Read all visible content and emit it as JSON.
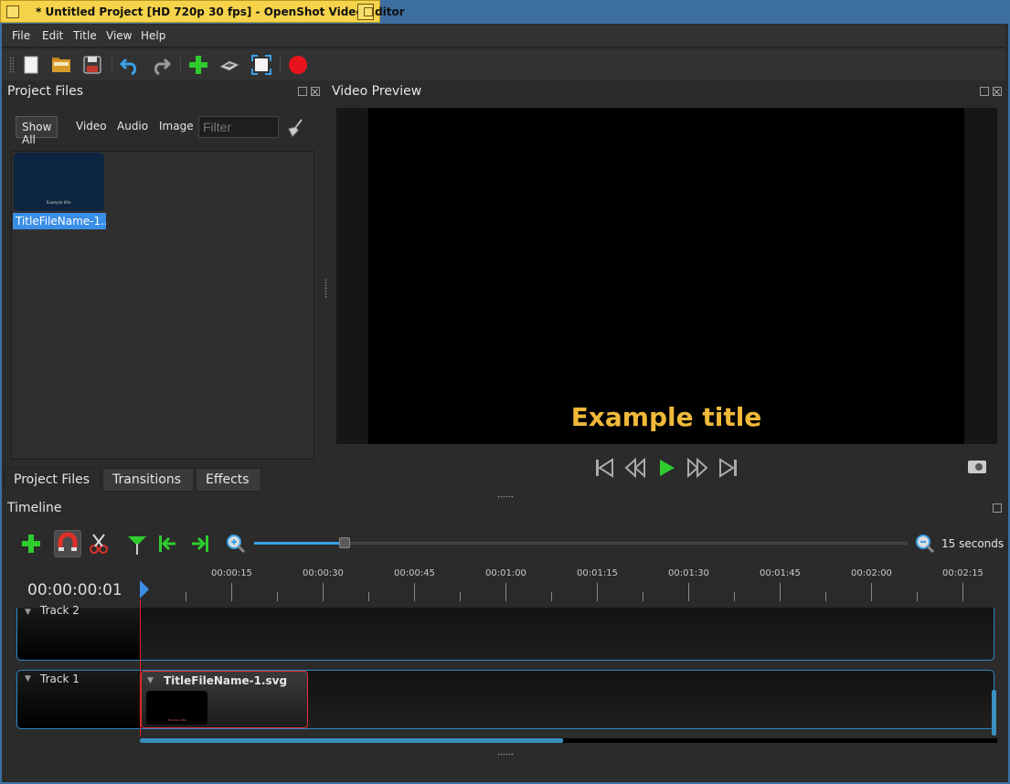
{
  "window": {
    "title": "* Untitled Project [HD 720p 30 fps] - OpenShot Video Editor"
  },
  "menu": [
    "File",
    "Edit",
    "Title",
    "View",
    "Help"
  ],
  "toolbar": {
    "icons": [
      "new-project-icon",
      "open-project-icon",
      "save-project-icon",
      "undo-icon",
      "redo-icon",
      "import-files-icon",
      "profile-icon",
      "fullscreen-icon",
      "export-video-icon"
    ]
  },
  "project_files": {
    "title": "Project Files",
    "filters": [
      "Show All",
      "Video",
      "Audio",
      "Image"
    ],
    "filter_placeholder": "Filter",
    "items": [
      {
        "label": "TitleFileName-1....",
        "thumb_text": "Example title"
      }
    ]
  },
  "bottom_tabs": [
    "Project Files",
    "Transitions",
    "Effects"
  ],
  "preview": {
    "title": "Video Preview",
    "overlay_text": "Example title",
    "title_color": "#f0b93a"
  },
  "timeline": {
    "title": "Timeline",
    "zoom_label": "15 seconds",
    "zoom_level": 0.14,
    "timecode": "00:00:00:01",
    "ticks": [
      "00:00:15",
      "00:00:30",
      "00:00:45",
      "00:01:00",
      "00:01:15",
      "00:01:30",
      "00:01:45",
      "00:02:00",
      "00:02:15"
    ],
    "tracks": [
      {
        "name": "Track 2"
      },
      {
        "name": "Track 1"
      }
    ],
    "clip": {
      "name": "TitleFileName-1.svg",
      "thumb_text": "Example title"
    },
    "scroll_position": 0.49
  },
  "colors": {
    "accent": "#3a8ee6",
    "track_border": "#2b88c8",
    "playhead": "#e02020",
    "titlebar": "#3c6ea0",
    "title_tab": "#f5d34a"
  }
}
